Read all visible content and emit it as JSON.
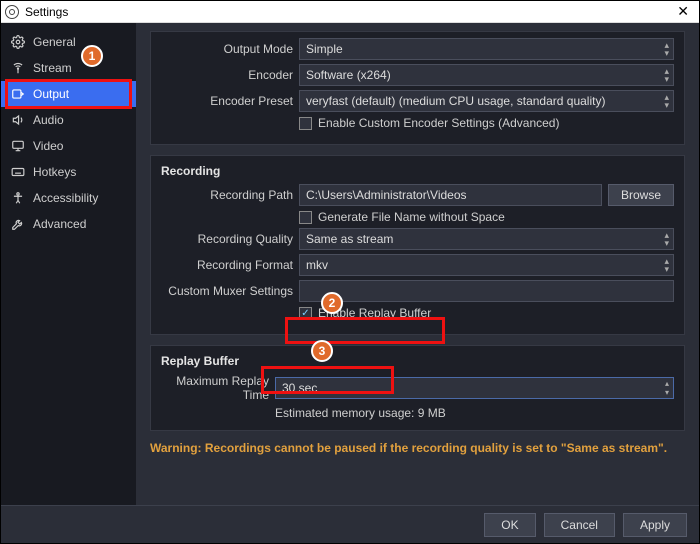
{
  "titlebar": {
    "title": "Settings",
    "close": "✕"
  },
  "sidebar": {
    "items": [
      {
        "label": "General"
      },
      {
        "label": "Stream"
      },
      {
        "label": "Output"
      },
      {
        "label": "Audio"
      },
      {
        "label": "Video"
      },
      {
        "label": "Hotkeys"
      },
      {
        "label": "Accessibility"
      },
      {
        "label": "Advanced"
      }
    ]
  },
  "streaming": {
    "output_mode_label": "Output Mode",
    "output_mode_value": "Simple",
    "encoder_label": "Encoder",
    "encoder_value": "Software (x264)",
    "preset_label": "Encoder Preset",
    "preset_value": "veryfast (default) (medium CPU usage, standard quality)",
    "advanced_cb_label": "Enable Custom Encoder Settings (Advanced)"
  },
  "recording": {
    "title": "Recording",
    "path_label": "Recording Path",
    "path_value": "C:\\Users\\Administrator\\Videos",
    "browse": "Browse",
    "gen_filename_label": "Generate File Name without Space",
    "quality_label": "Recording Quality",
    "quality_value": "Same as stream",
    "format_label": "Recording Format",
    "format_value": "mkv",
    "muxer_label": "Custom Muxer Settings",
    "muxer_value": "",
    "replay_cb_label": "Enable Replay Buffer"
  },
  "replay": {
    "title": "Replay Buffer",
    "time_label": "Maximum Replay Time",
    "time_value": "30 sec",
    "memory": "Estimated memory usage: 9 MB"
  },
  "warning": "Warning: Recordings cannot be paused if the recording quality is set to \"Same as stream\".",
  "buttons": {
    "ok": "OK",
    "cancel": "Cancel",
    "apply": "Apply"
  },
  "annotations": {
    "badge1": "1",
    "badge2": "2",
    "badge3": "3"
  }
}
